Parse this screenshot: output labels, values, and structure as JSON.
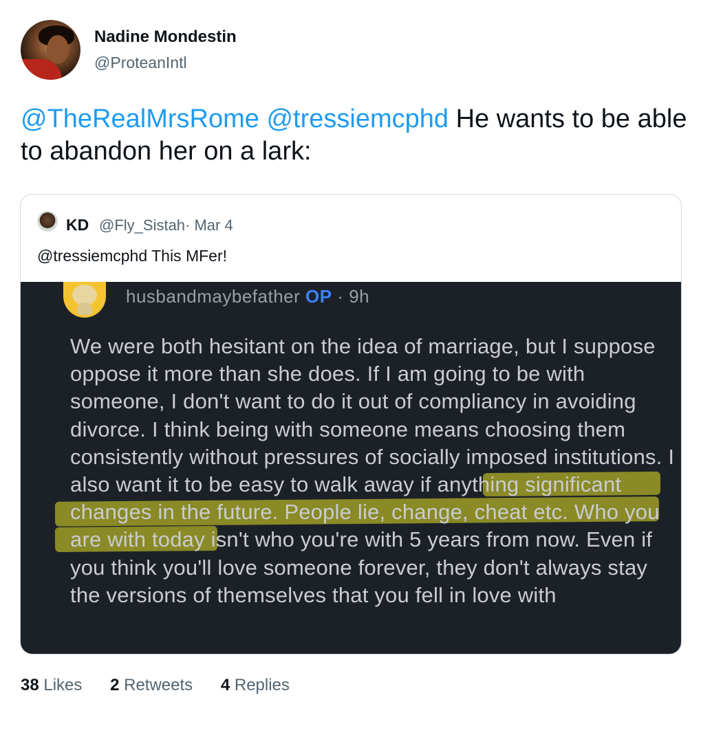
{
  "author": {
    "name": "Nadine Mondestin",
    "handle": "@ProteanIntl"
  },
  "tweet": {
    "mention_1": "@TheRealMrsRome",
    "mention_2": "@tressiemcphd",
    "text": "He wants to be able to abandon her on a lark:"
  },
  "quoted": {
    "name": "KD",
    "handle_date": "@Fly_Sistah· Mar 4",
    "text": "@tressiemcphd This MFer!",
    "screenshot": {
      "username": "husbandmaybefather",
      "op_badge": "OP",
      "time": "· 9h",
      "body": "We were both hesitant on the idea of marriage, but I suppose oppose it more than she does. If I am going to be with someone, I don't want to do it out of compliancy in avoiding divorce. I think being with someone means choosing them consistently without pressures of socially imposed institutions. I also want it to be easy to walk away if anything significant changes in the future. People lie, change, cheat etc. Who you are with today isn't who you're with 5 years from now. Even if you think you'll love someone forever, they don't always stay the versions of themselves that you fell in love with"
    }
  },
  "stats": {
    "likes_count": "38",
    "likes_label": "Likes",
    "retweets_count": "2",
    "retweets_label": "Retweets",
    "replies_count": "4",
    "replies_label": "Replies"
  },
  "colors": {
    "link": "#1d9bf0",
    "highlight": "#e5e224",
    "screenshot_bg": "#1c2128"
  }
}
